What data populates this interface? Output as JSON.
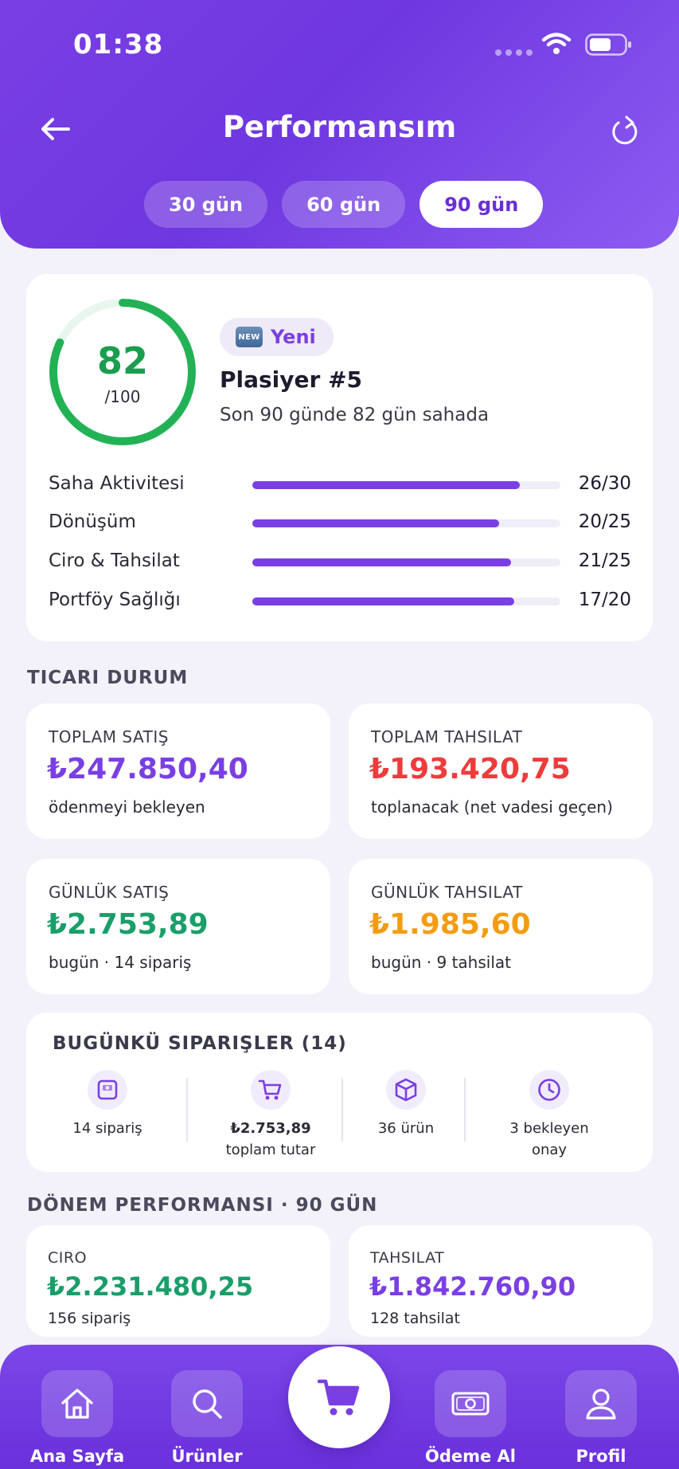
{
  "status_bar": {
    "time": "01:38"
  },
  "header": {
    "title": "Performansım",
    "periods": [
      {
        "label": "30 gün",
        "active": false
      },
      {
        "label": "60 gün",
        "active": false
      },
      {
        "label": "90 gün",
        "active": true
      }
    ]
  },
  "score": {
    "value": "82",
    "max": "/100",
    "fraction": 0.82,
    "badge": "Yeni",
    "badge_icon": "NEW",
    "name": "Plasiyer #5",
    "subtitle": "Son 90 günde 82 gün sahada",
    "metrics": [
      {
        "label": "Saha Aktivitesi",
        "value": "26/30",
        "fraction": 0.867
      },
      {
        "label": "Dönüşüm",
        "value": "20/25",
        "fraction": 0.8
      },
      {
        "label": "Ciro & Tahsilat",
        "value": "21/25",
        "fraction": 0.84
      },
      {
        "label": "Portföy Sağlığı",
        "value": "17/20",
        "fraction": 0.85
      }
    ]
  },
  "commercial": {
    "title": "TICARI DURUM",
    "cards": [
      {
        "label": "TOPLAM SATIŞ",
        "value": "₺247.850,40",
        "sub": "ödenmeyi bekleyen",
        "color": "#7a3fe4"
      },
      {
        "label": "TOPLAM TAHSILAT",
        "value": "₺193.420,75",
        "sub": "toplanacak (net vadesi geçen)",
        "color": "#ee3b3b"
      },
      {
        "label": "GÜNLÜK SATIŞ",
        "value": "₺2.753,89",
        "sub": "bugün · 14 sipariş",
        "color": "#1a9e6a"
      },
      {
        "label": "GÜNLÜK TAHSILAT",
        "value": "₺1.985,60",
        "sub": "bugün · 9 tahsilat",
        "color": "#f39c12"
      }
    ]
  },
  "orders": {
    "title": "BUGÜNKÜ SIPARIŞLER (14)",
    "items": [
      {
        "line1": "14 sipariş",
        "line2": "",
        "icon": "order-box-icon"
      },
      {
        "line1": "₺2.753,89",
        "line2": "toplam tutar",
        "icon": "cart-icon"
      },
      {
        "line1": "36 ürün",
        "line2": "",
        "icon": "package-icon"
      },
      {
        "line1": "3 bekleyen",
        "line2": "onay",
        "icon": "clock-icon"
      }
    ]
  },
  "period_perf": {
    "title": "DÖNEM PERFORMANSI · 90 GÜN",
    "cards": [
      {
        "label": "CIRO",
        "value": "₺2.231.480,25",
        "sub": "156 sipariş",
        "color": "#1a9e6a"
      },
      {
        "label": "TAHSILAT",
        "value": "₺1.842.760,90",
        "sub": "128 tahsilat",
        "color": "#7a3fe4"
      }
    ]
  },
  "nav": {
    "home": "Ana Sayfa",
    "products": "Ürünler",
    "payment": "Ödeme Al",
    "profile": "Profil"
  }
}
